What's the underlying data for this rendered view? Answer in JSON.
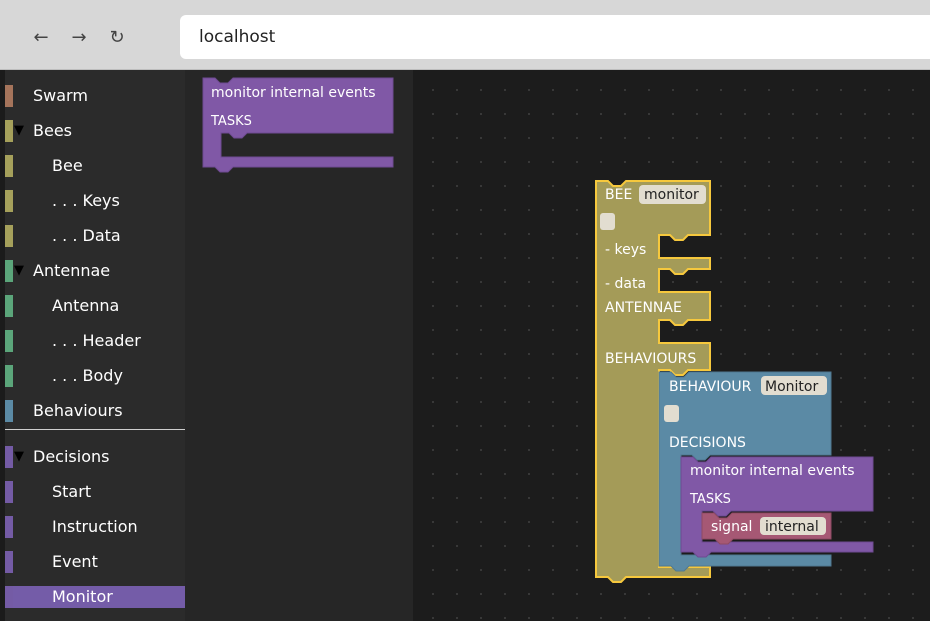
{
  "browser": {
    "url": "localhost",
    "back_icon": "←",
    "forward_icon": "→",
    "reload_icon": "↻"
  },
  "toolbox": {
    "items": [
      {
        "label": "Swarm",
        "color": "#a5745b",
        "expanded": null,
        "indent": 1
      },
      {
        "label": "Bees",
        "color": "#a5a05b",
        "expanded": true,
        "indent": 1
      },
      {
        "label": "Bee",
        "color": "#a5a05b",
        "expanded": null,
        "indent": 2
      },
      {
        "label": ". . . Keys",
        "color": "#a5a05b",
        "expanded": null,
        "indent": 2
      },
      {
        "label": ". . . Data",
        "color": "#a5a05b",
        "expanded": null,
        "indent": 2
      },
      {
        "label": "Antennae",
        "color": "#5ba57a",
        "expanded": true,
        "indent": 1
      },
      {
        "label": "Antenna",
        "color": "#5ba57a",
        "expanded": null,
        "indent": 2
      },
      {
        "label": ". . . Header",
        "color": "#5ba57a",
        "expanded": null,
        "indent": 2
      },
      {
        "label": ". . . Body",
        "color": "#5ba57a",
        "expanded": null,
        "indent": 2
      },
      {
        "label": "Behaviours",
        "color": "#5b8aa5",
        "expanded": null,
        "indent": 1
      },
      {
        "label": "Decisions",
        "color": "#745ba5",
        "expanded": true,
        "indent": 1
      },
      {
        "label": "Start",
        "color": "#745ba5",
        "expanded": null,
        "indent": 2
      },
      {
        "label": "Instruction",
        "color": "#745ba5",
        "expanded": null,
        "indent": 2
      },
      {
        "label": "Event",
        "color": "#745ba5",
        "expanded": null,
        "indent": 2
      },
      {
        "label": "Monitor",
        "color": "#745ba5",
        "expanded": null,
        "indent": 2,
        "selected": true
      }
    ],
    "expanded_glyph": "▼"
  },
  "flyout": {
    "block": {
      "title": "monitor internal events",
      "tasks_label": "TASKS",
      "color": "#8058a6"
    }
  },
  "workspace": {
    "bee_block": {
      "label": "BEE",
      "name": "monitor",
      "color": "#a49b58",
      "selected_outline": "#f6c83d",
      "keys_label": "- keys",
      "data_label": "- data",
      "antennae_label": "ANTENNAE",
      "behaviours_label": "BEHAVIOURS"
    },
    "behaviour_block": {
      "label": "BEHAVIOUR",
      "name": "Monitor",
      "decisions_label": "DECISIONS",
      "color": "#5b8aa5"
    },
    "monitor_block": {
      "title": "monitor internal events",
      "tasks_label": "TASKS",
      "color": "#8058a6"
    },
    "signal_block": {
      "label": "signal",
      "value": "internal",
      "color": "#a65874"
    }
  },
  "colors": {
    "field_bg": "#e2ddd0",
    "toolbox_bg": "#2b2b2b",
    "workspace_bg": "#1c1c1c"
  }
}
